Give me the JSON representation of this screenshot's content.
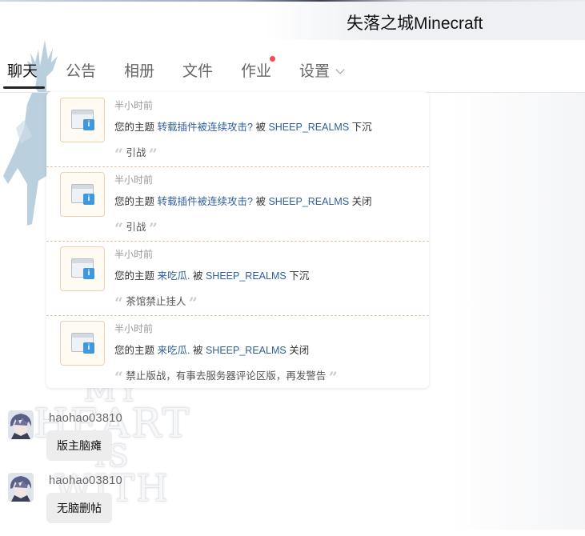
{
  "header": {
    "group_name": "失落之城Minecraft"
  },
  "tabs": [
    {
      "label": "聊天",
      "active": true
    },
    {
      "label": "公告"
    },
    {
      "label": "相册"
    },
    {
      "label": "文件"
    },
    {
      "label": "作业",
      "has_badge_dot": true
    },
    {
      "label": "设置",
      "has_dropdown": true
    }
  ],
  "notices": [
    {
      "time": "半小时前",
      "prefix": "您的主题",
      "topic": "转载插件被连续攻击?",
      "by": "被",
      "user": "SHEEP_REALMS",
      "action": "下沉",
      "reason": "引战"
    },
    {
      "time": "半小时前",
      "prefix": "您的主题",
      "topic": "转载插件被连续攻击?",
      "by": "被",
      "user": "SHEEP_REALMS",
      "action": "关闭",
      "reason": "引战"
    },
    {
      "time": "半小时前",
      "prefix": "您的主题",
      "topic": "来吃瓜.",
      "by": "被",
      "user": "SHEEP_REALMS",
      "action": "下沉",
      "reason": "茶馆禁止挂人"
    },
    {
      "time": "半小时前",
      "prefix": "您的主题",
      "topic": "来吃瓜.",
      "by": "被",
      "user": "SHEEP_REALMS",
      "action": "关闭",
      "reason": "禁止版战，有事去服务器评论区版，再发警告"
    }
  ],
  "messages": [
    {
      "sender": "haohao03810",
      "text": "版主脑瘫"
    },
    {
      "sender": "haohao03810",
      "text": "无脑删帖"
    }
  ],
  "background_text": [
    "MY",
    "HEART",
    "IS",
    "WITH"
  ],
  "colors": {
    "link": "#2f5f9e",
    "badge": "#f24c4c",
    "notice_border": "#e0c4a3",
    "info_icon": "#3f97dc"
  }
}
